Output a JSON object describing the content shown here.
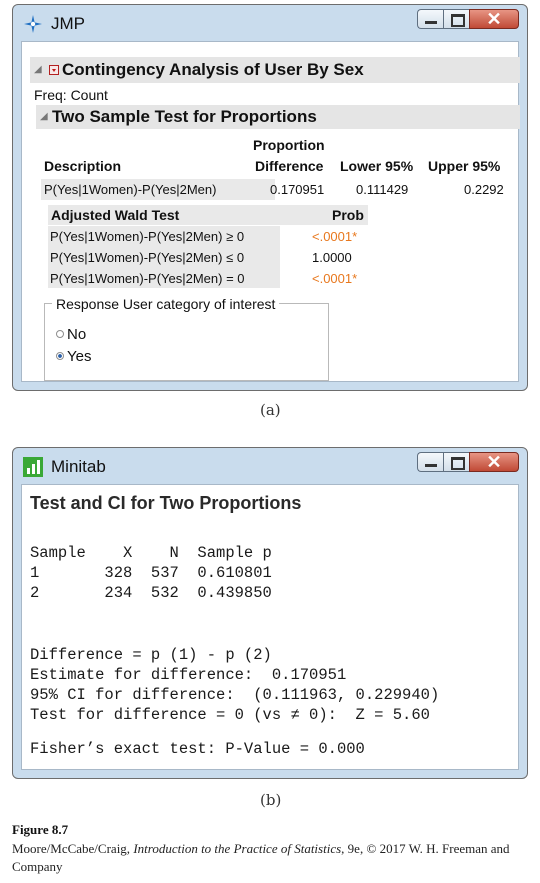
{
  "jmp": {
    "window_title": "JMP",
    "report_title": "Contingency Analysis of User By Sex",
    "freq_label": "Freq: Count",
    "section_title": "Two Sample Test for Proportions",
    "table": {
      "col_description": "Description",
      "col_proportion_line1": "Proportion",
      "col_proportion_line2": "Difference",
      "col_lower": "Lower 95%",
      "col_upper": "Upper 95%",
      "row": {
        "description": "P(Yes|1Women)-P(Yes|2Men)",
        "difference": "0.170951",
        "lower": "0.111429",
        "upper": "0.2292"
      }
    },
    "wald": {
      "col_test": "Adjusted Wald Test",
      "col_prob": "Prob",
      "rows": [
        {
          "test": "P(Yes|1Women)-P(Yes|2Men) ≥ 0",
          "prob": "<.0001*"
        },
        {
          "test": "P(Yes|1Women)-P(Yes|2Men) ≤ 0",
          "prob": "1.0000"
        },
        {
          "test": "P(Yes|1Women)-P(Yes|2Men) = 0",
          "prob": "<.0001*"
        }
      ]
    },
    "response": {
      "legend": "Response User category of interest",
      "options": [
        "No",
        "Yes"
      ],
      "selected": "Yes"
    }
  },
  "caption_a": "(a)",
  "minitab": {
    "window_title": "Minitab",
    "heading": "Test and CI for Two Proportions",
    "lines": [
      "Sample    X    N  Sample p",
      "1       328  537  0.610801",
      "2       234  532  0.439850",
      "Difference = p (1) - p (2)",
      "Estimate for difference:  0.170951",
      "95% CI for difference:  (0.111963, 0.229940)",
      "Test for difference = 0 (vs ≠ 0):  Z = 5.60",
      "Fisher’s exact test: P-Value = 0.000"
    ]
  },
  "caption_b": "(b)",
  "figure": {
    "label": "Figure 8.7",
    "credit_authors": "Moore/McCabe/Craig, ",
    "credit_book": "Introduction to the Practice of Statistics",
    "credit_rest": ", 9e, © 2017 W. H. Freeman and Company"
  },
  "icons": {
    "jmp_logo": "jmp-star-icon",
    "minitab_logo": "bar-chart-icon",
    "minimize": "minimize-icon",
    "maximize": "maximize-icon",
    "close": "close-icon"
  },
  "colors": {
    "window_frame": "#c9dced",
    "close_button": "#c04a36",
    "significant_prob": "#e8781e",
    "minitab_logo": "#3aa836",
    "jmp_logo": "#1f6fc2"
  }
}
